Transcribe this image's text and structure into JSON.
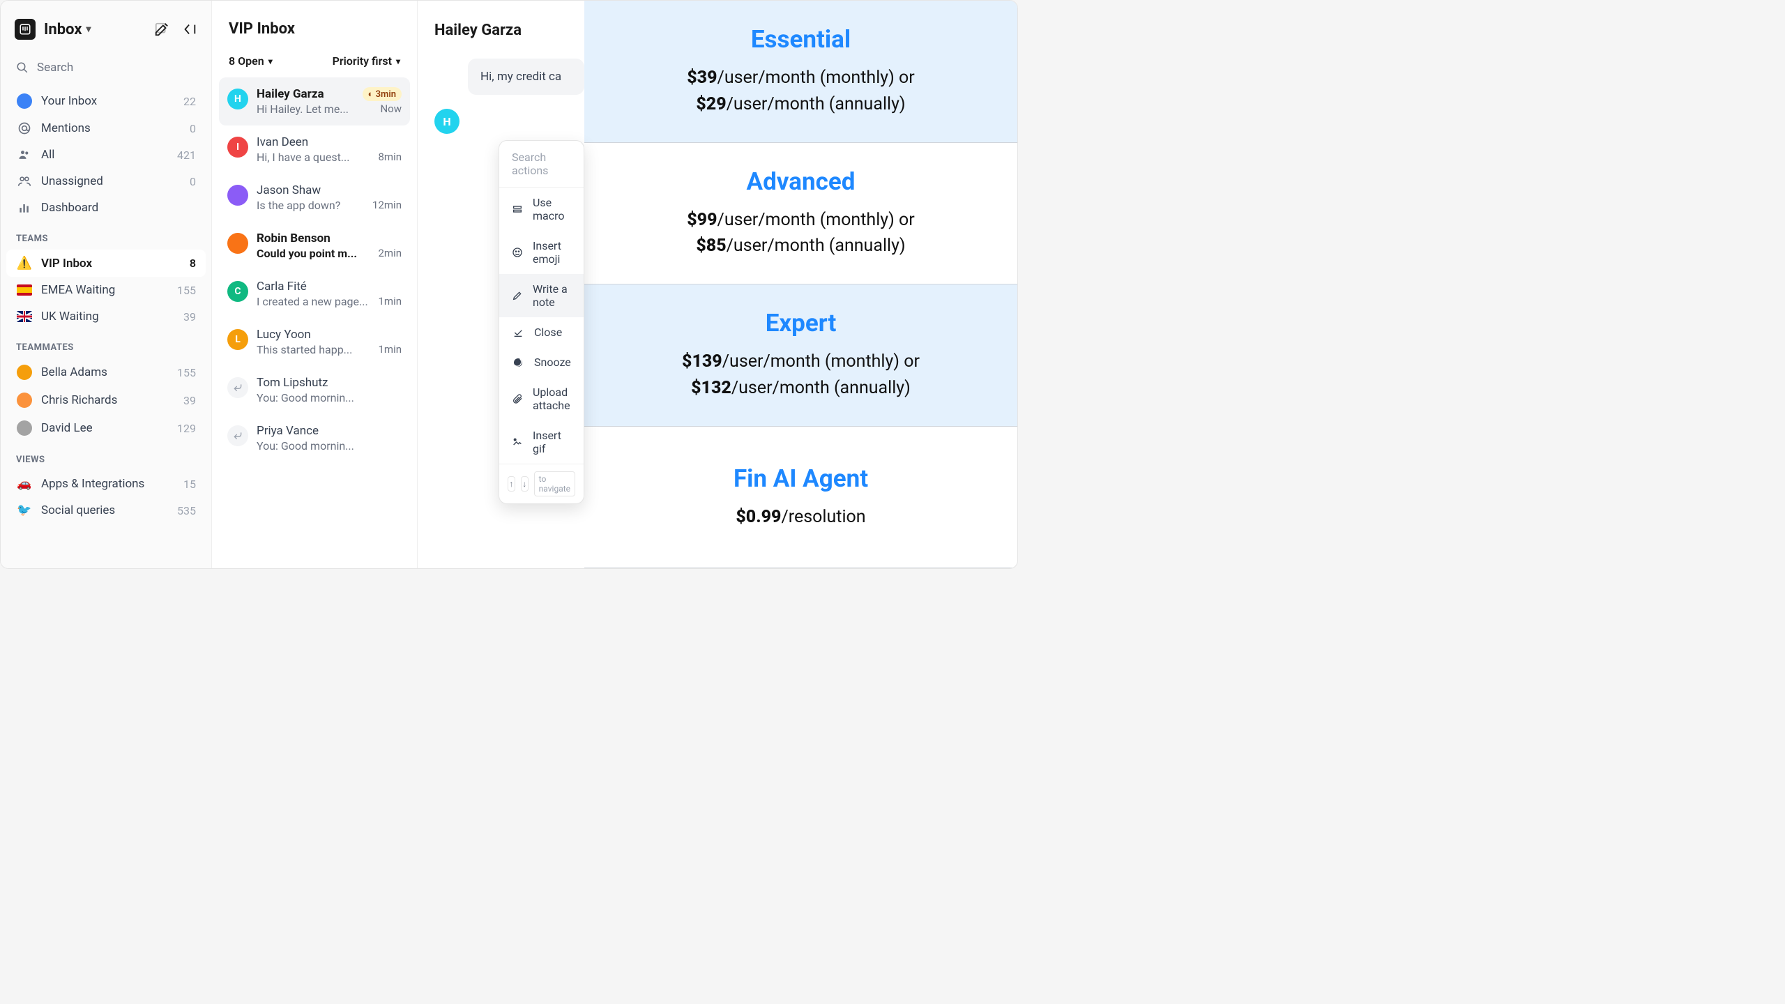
{
  "sidebar": {
    "title": "Inbox",
    "search": "Search",
    "nav": [
      {
        "label": "Your Inbox",
        "count": "22",
        "icon": "avatar",
        "color": "#3b82f6"
      },
      {
        "label": "Mentions",
        "count": "0",
        "icon": "at"
      },
      {
        "label": "All",
        "count": "421",
        "icon": "people"
      },
      {
        "label": "Unassigned",
        "count": "0",
        "icon": "group"
      },
      {
        "label": "Dashboard",
        "count": "",
        "icon": "bars"
      }
    ],
    "teams_label": "TEAMS",
    "teams": [
      {
        "label": "VIP Inbox",
        "count": "8",
        "icon": "⚠️",
        "active": true
      },
      {
        "label": "EMEA Waiting",
        "count": "155",
        "flag": "es"
      },
      {
        "label": "UK Waiting",
        "count": "39",
        "flag": "uk"
      }
    ],
    "teammates_label": "TEAMMATES",
    "teammates": [
      {
        "label": "Bella Adams",
        "count": "155",
        "color": "#f59e0b"
      },
      {
        "label": "Chris Richards",
        "count": "39",
        "color": "#fb923c"
      },
      {
        "label": "David Lee",
        "count": "129",
        "color": "#a3a3a3"
      }
    ],
    "views_label": "VIEWS",
    "views": [
      {
        "label": "Apps & Integrations",
        "count": "15",
        "icon": "🚗"
      },
      {
        "label": "Social queries",
        "count": "535",
        "icon": "🐦"
      }
    ]
  },
  "list": {
    "title": "VIP Inbox",
    "open": "8 Open",
    "sort": "Priority first",
    "items": [
      {
        "name": "Hailey Garza",
        "preview": "Hi Hailey. Let me...",
        "pill": "3min",
        "time": "Now",
        "av": "H",
        "color": "#22d3ee",
        "sel": true
      },
      {
        "name": "Ivan Deen",
        "preview": "Hi, I have a quest...",
        "time": "8min",
        "av": "I",
        "color": "#ef4444"
      },
      {
        "name": "Jason Shaw",
        "preview": "Is the app down?",
        "time": "12min",
        "av": "",
        "color": "#8b5cf6",
        "img": true
      },
      {
        "name": "Robin Benson",
        "preview": "Could you point m...",
        "time": "2min",
        "av": "",
        "color": "#f97316",
        "img": true,
        "bold": true
      },
      {
        "name": "Carla Fité",
        "preview": "I created a new page...",
        "time": "1min",
        "av": "C",
        "color": "#10b981"
      },
      {
        "name": "Lucy Yoon",
        "preview": "This started happ...",
        "time": "1min",
        "av": "L",
        "color": "#f59e0b"
      },
      {
        "name": "Tom Lipshutz",
        "preview": "You: Good mornin...",
        "time": "",
        "reply": true
      },
      {
        "name": "Priya Vance",
        "preview": "You: Good mornin...",
        "time": "",
        "reply": true
      }
    ]
  },
  "detail": {
    "title": "Hailey Garza",
    "msg": "Hi, my credit ca",
    "av": "H",
    "search_placeholder": "Search actions",
    "actions": [
      {
        "label": "Use macro",
        "icon": "macro"
      },
      {
        "label": "Insert emoji",
        "icon": "emoji"
      },
      {
        "label": "Write a note",
        "icon": "note",
        "hl": true
      },
      {
        "label": "Close",
        "icon": "close"
      },
      {
        "label": "Snooze",
        "icon": "snooze"
      },
      {
        "label": "Upload attache",
        "icon": "attach"
      },
      {
        "label": "Insert gif",
        "icon": "gif"
      }
    ],
    "nav_hint": "to navigate"
  },
  "pricing": [
    {
      "name": "Essential",
      "p1": "$39",
      "s1": "/user/month (monthly) or",
      "p2": "$29",
      "s2": "/user/month (annually)",
      "blue": true
    },
    {
      "name": "Advanced",
      "p1": "$99",
      "s1": "/user/month (monthly) or",
      "p2": "$85",
      "s2": "/user/month (annually)",
      "blue": false
    },
    {
      "name": "Expert",
      "p1": "$139",
      "s1": "/user/month (monthly) or",
      "p2": "$132",
      "s2": "/user/month (annually)",
      "blue": true
    },
    {
      "name": "Fin AI Agent",
      "p1": "$0.99",
      "s1": "/resolution",
      "blue": false,
      "single": true
    }
  ]
}
